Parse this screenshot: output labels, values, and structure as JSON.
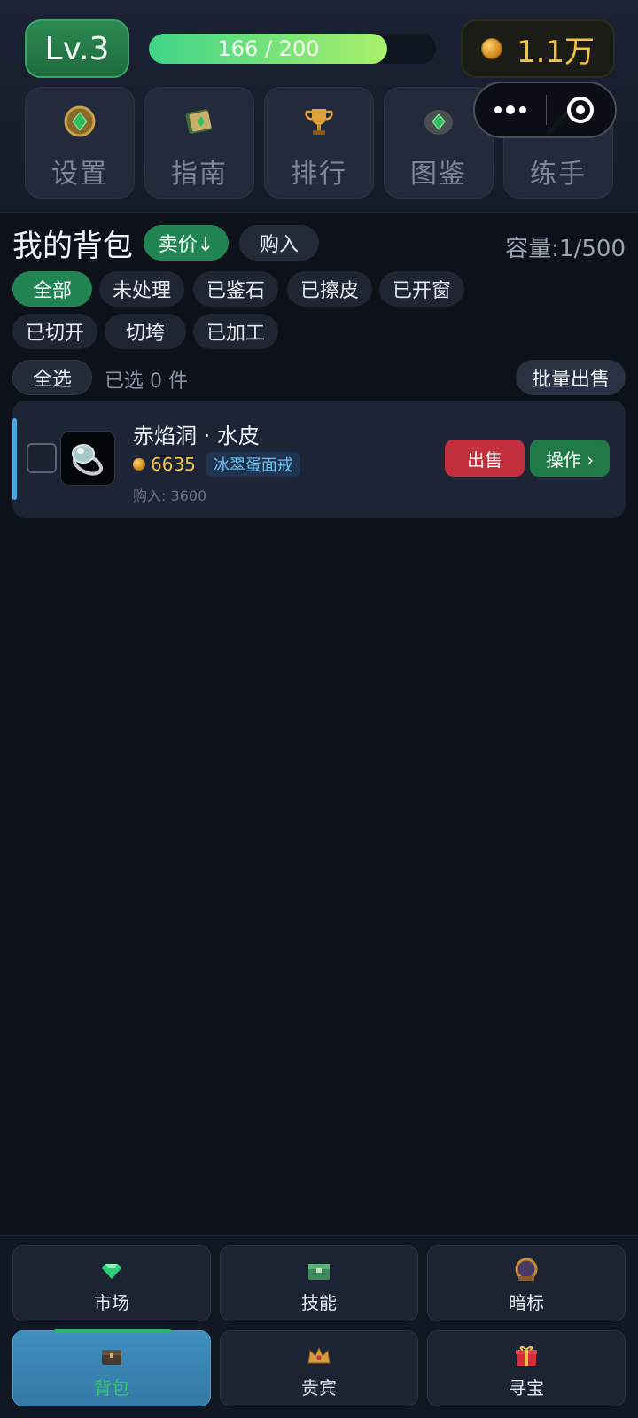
{
  "header": {
    "level_label": "Lv.3",
    "xp_text": "166 / 200",
    "xp_progress": 0.83,
    "coins_label": "1.1万",
    "tools": [
      {
        "label": "设置",
        "icon": "emerald-amulet-icon"
      },
      {
        "label": "指南",
        "icon": "guide-book-icon"
      },
      {
        "label": "排行",
        "icon": "trophy-icon"
      },
      {
        "label": "图鉴",
        "icon": "gem-stone-icon"
      },
      {
        "label": "练手",
        "icon": "carving-knife-icon"
      }
    ]
  },
  "bag": {
    "title": "我的背包",
    "sort_label": "卖价↓",
    "buy_label": "购入",
    "capacity": "容量:1/500",
    "filters": [
      "全部",
      "未处理",
      "已鉴石",
      "已擦皮",
      "已开窗",
      "已切开",
      "切垮",
      "已加工"
    ],
    "active_filter": "全部",
    "select_all": "全选",
    "selected_text": "已选 0 件",
    "batch_sell": "批量出售",
    "items": [
      {
        "name": "赤焰洞 · 水皮",
        "price": "6635",
        "tag": "冰翠蛋面戒",
        "bought": "购入: 3600",
        "sell_label": "出售",
        "op_label": "操作 ›"
      }
    ]
  },
  "nav": {
    "items": [
      {
        "label": "市场",
        "icon": "diamond-icon"
      },
      {
        "label": "技能",
        "icon": "jade-chest-icon"
      },
      {
        "label": "暗标",
        "icon": "bid-seal-icon"
      },
      {
        "label": "背包",
        "icon": "backpack-chest-icon"
      },
      {
        "label": "贵宾",
        "icon": "crown-icon"
      },
      {
        "label": "寻宝",
        "icon": "gift-box-icon"
      }
    ],
    "active": "背包"
  },
  "colors": {
    "accent_green": "#238453",
    "gold": "#f3c246",
    "sell_red": "#c1303c",
    "nav_active": "#3e8fbf"
  }
}
